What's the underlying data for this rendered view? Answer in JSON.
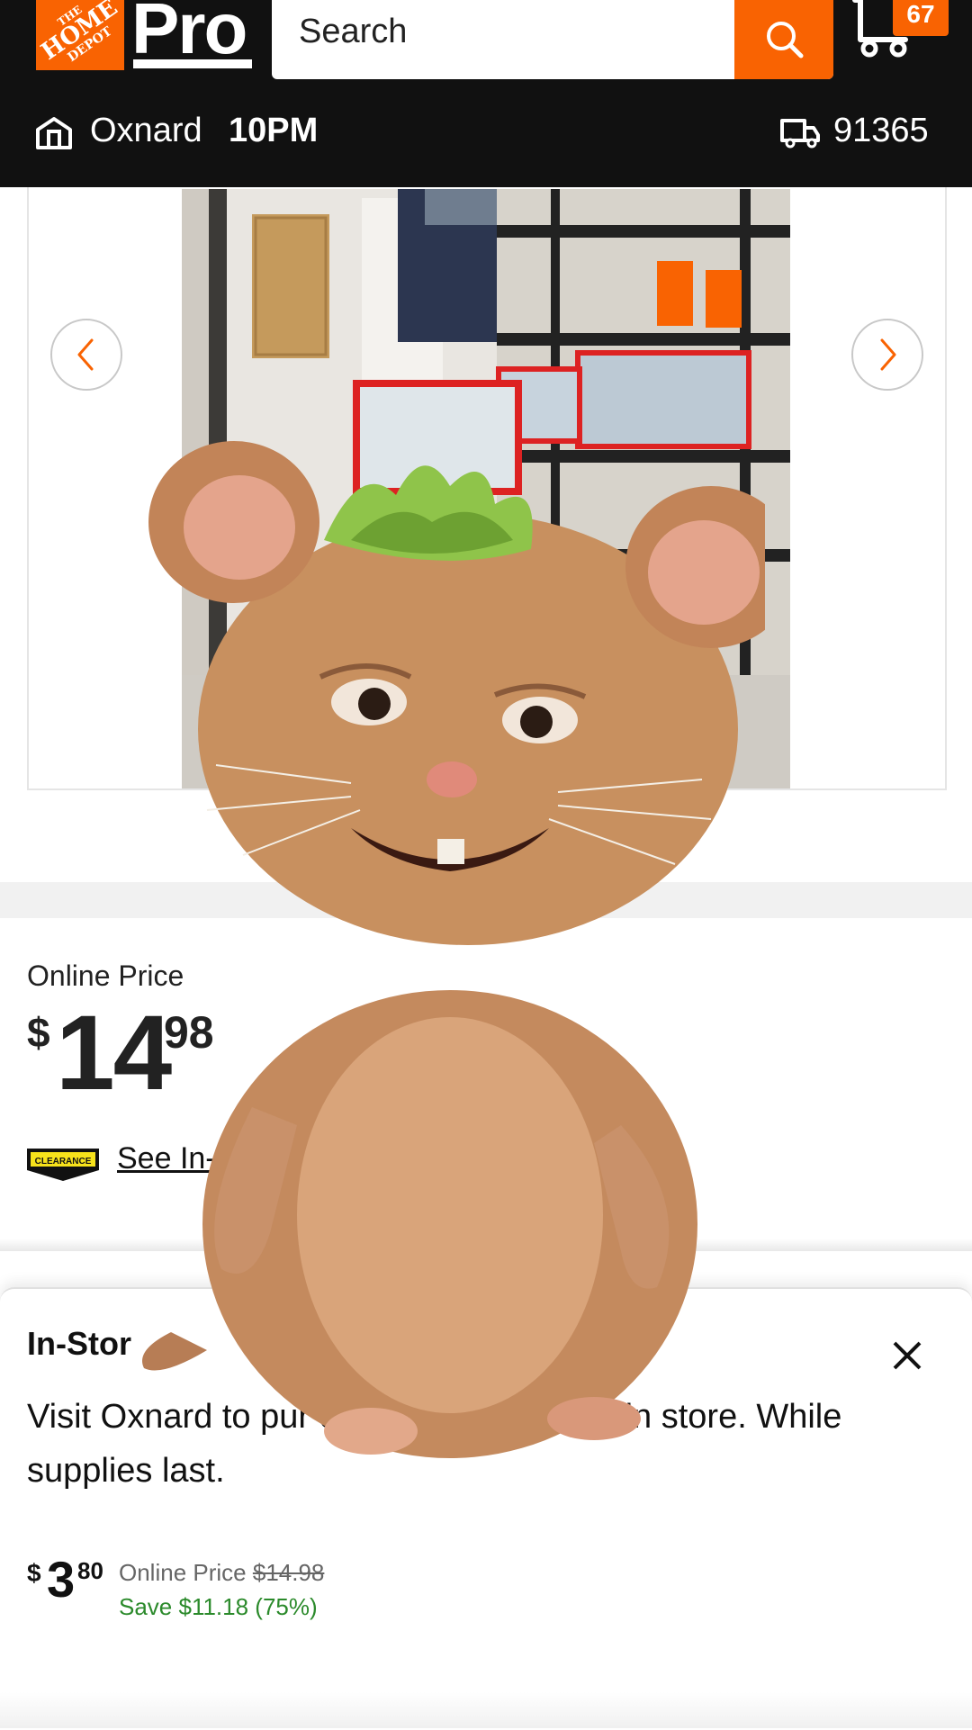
{
  "brand": {
    "logo_lines": [
      "THE",
      "HOME",
      "DEPOT"
    ],
    "pro_label": "Pro",
    "accent_color": "#f96302"
  },
  "search": {
    "placeholder": "Search"
  },
  "cart": {
    "count": "67"
  },
  "store": {
    "name": "Oxnard",
    "hours": "10PM",
    "zip": "91365"
  },
  "gallery": {
    "prev_icon": "chevron-left-icon",
    "next_icon": "chevron-right-icon"
  },
  "pricing": {
    "online_label": "Online Price",
    "dollar_sign": "$",
    "whole": "14",
    "cents": "98",
    "clearance_badge": "CLEARANCE",
    "see_instore": "See In-S"
  },
  "instore_sheet": {
    "title": "In-Stor",
    "body": "Visit Oxnard to pur e this item learance in store. While supplies last.",
    "price_dollar": "$",
    "price_whole": "3",
    "price_cents": "80",
    "online_label": "Online Price",
    "online_old": "$14.98",
    "savings": "Save $11.18 (75%)",
    "savings_color": "#2b8a2b"
  }
}
